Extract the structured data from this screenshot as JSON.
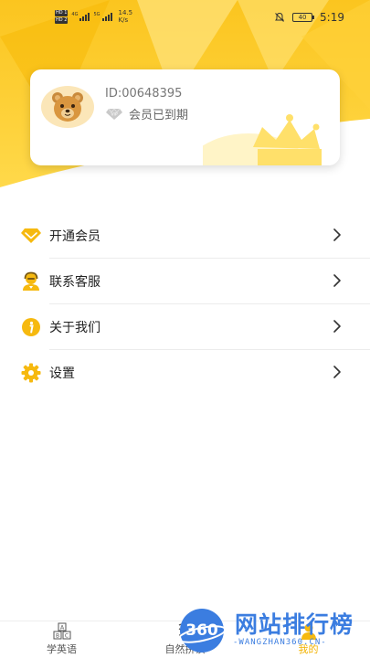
{
  "status_bar": {
    "hd1": "HD 1",
    "hd2": "HD 2",
    "net1": "4G",
    "net2": "5G",
    "speed_value": "14.5",
    "speed_unit": "K/s",
    "battery": "40",
    "time": "5:19"
  },
  "profile": {
    "user_id": "ID:00648395",
    "vip_badge": "VIP",
    "member_status": "会员已到期",
    "avatar_icon": "bear-avatar-icon"
  },
  "menu": {
    "items": [
      {
        "label": "开通会员",
        "icon": "diamond-icon"
      },
      {
        "label": "联系客服",
        "icon": "customer-service-icon"
      },
      {
        "label": "关于我们",
        "icon": "info-icon"
      },
      {
        "label": "设置",
        "icon": "gear-icon"
      }
    ],
    "arrow_icon": "chevron-right-icon"
  },
  "bottom_nav": {
    "tabs": [
      {
        "label": "学英语",
        "icon": "abc-blocks-icon",
        "active": false
      },
      {
        "label": "自然拼读",
        "icon": "phonics-icon",
        "active": false
      },
      {
        "label": "我的",
        "icon": "profile-icon",
        "active": true
      }
    ]
  },
  "watermark": {
    "logo_text": "360",
    "title": "网站排行榜",
    "subtitle": "-WANGZHAN360.CN-"
  },
  "colors": {
    "accent_yellow": "#f9c21a",
    "header_light": "#ffe27a",
    "header_white": "#fff8d8",
    "watermark_blue": "#3b7de0"
  }
}
